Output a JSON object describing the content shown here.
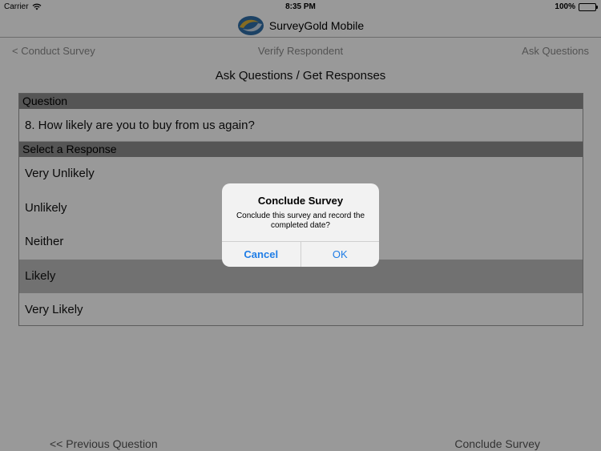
{
  "status_bar": {
    "carrier": "Carrier",
    "time": "8:35 PM",
    "battery": "100%",
    "battery_level": 1.0
  },
  "app": {
    "title": "SurveyGold Mobile",
    "logo_icon": "surveygold-swirl-logo"
  },
  "nav": {
    "back": "< Conduct Survey",
    "middle": "Verify Respondent",
    "right": "Ask Questions"
  },
  "page_title": "Ask Questions / Get Responses",
  "question": {
    "header": "Question",
    "text": "8. How likely are you to buy from us again?"
  },
  "responses": {
    "header": "Select a Response",
    "items": [
      {
        "label": "Very Unlikely",
        "selected": false
      },
      {
        "label": "Unlikely",
        "selected": false
      },
      {
        "label": "Neither",
        "selected": false
      },
      {
        "label": "Likely",
        "selected": true
      },
      {
        "label": "Very Likely",
        "selected": false
      }
    ]
  },
  "bottom": {
    "previous": "<< Previous Question",
    "conclude": "Conclude Survey"
  },
  "alert": {
    "title": "Conclude Survey",
    "message": "Conclude this survey and record the completed date?",
    "cancel": "Cancel",
    "ok": "OK"
  },
  "colors": {
    "accent": "#1f7de6",
    "section_header": "#8e8e8e",
    "selected_row": "#bcbcbc"
  }
}
